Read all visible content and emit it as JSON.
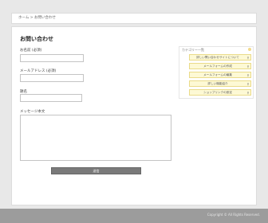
{
  "breadcrumb": "ホーム > お問い合わせ",
  "form": {
    "title": "お問い合わせ",
    "name_label": "お名前 (必須)",
    "name_value": "",
    "email_label": "メールアドレス (必須)",
    "email_value": "",
    "subject_label": "題名",
    "subject_value": "",
    "message_label": "メッセージ本文",
    "message_value": "",
    "submit_label": "送信"
  },
  "sidebar": {
    "title": "カテゴリー一覧",
    "items": [
      {
        "label": "詳しい問い合わせサイトについて"
      },
      {
        "label": "メールフォームの作成"
      },
      {
        "label": "メールフォームの編集"
      },
      {
        "label": "詳しい機能紹介"
      },
      {
        "label": "ショップリンクの設定"
      }
    ]
  },
  "footer": {
    "copyright": "Copyright © All Rights Reserved."
  }
}
